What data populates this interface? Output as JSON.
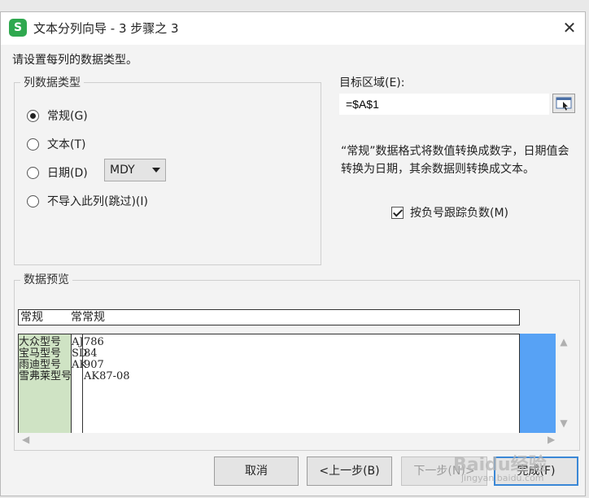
{
  "window": {
    "title": "文本分列向导 - 3 步骤之 3",
    "app_icon": "S"
  },
  "prompt": "请设置每列的数据类型。",
  "column_type": {
    "legend": "列数据类型",
    "options": [
      {
        "label": "常规(G)",
        "selected": true
      },
      {
        "label": "文本(T)",
        "selected": false
      },
      {
        "label": "日期(D)",
        "selected": false
      },
      {
        "label": "不导入此列(跳过)(I)",
        "selected": false
      }
    ],
    "date_format": "MDY"
  },
  "destination": {
    "label": "目标区域(E):",
    "value": "=$A$1"
  },
  "description": "“常规”数据格式将数值转换成数字，日期值会转换为日期，其余数据则转换成文本。",
  "negative_checkbox": {
    "label": "按负号跟踪负数(M)",
    "checked": true
  },
  "preview": {
    "legend": "数据预览",
    "header": [
      "常规",
      "常",
      "常规"
    ],
    "rows": [
      [
        "大众型号",
        "AJ",
        "786"
      ],
      [
        "宝马型号",
        "SD",
        "84"
      ],
      [
        "雨迪型号",
        "AK",
        "907"
      ],
      [
        "雪弗莱型号",
        "",
        "AK87-08"
      ]
    ]
  },
  "buttons": {
    "cancel": "取消",
    "back": "<上一步(B)",
    "next": "下一步(N)>",
    "finish": "完成(F)"
  },
  "watermark": {
    "text": "Baidu经验",
    "sub": "jingyan.baidu.com"
  },
  "colors": {
    "selected_column": "#cfe3c4",
    "scrollbar": "#57a2f5",
    "app_icon": "#2fa84f"
  }
}
